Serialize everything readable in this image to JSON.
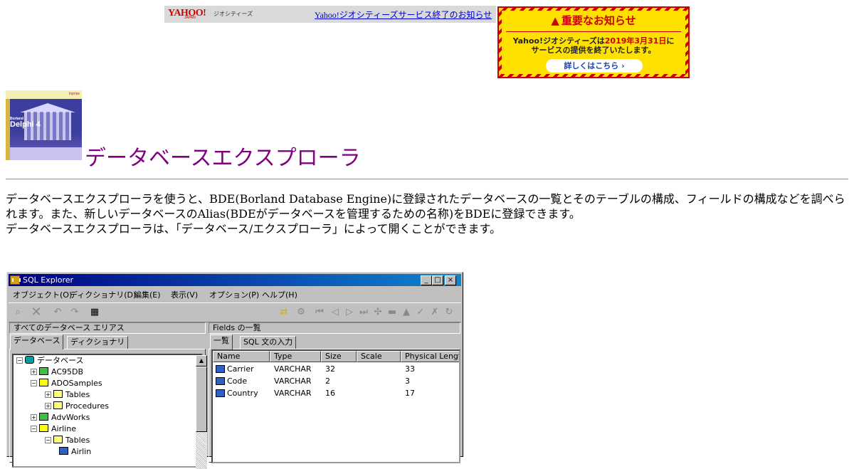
{
  "yahoo_bar": {
    "logo": "YAHOO!",
    "logo_sub": "JAPAN",
    "geocities": "ジオシティーズ",
    "link": "Yahoo!ジオシティーズサービス終了のお知らせ"
  },
  "notice": {
    "title": "重要なお知らせ",
    "line1_a": "Yahoo!ジオシティーズは",
    "line1_date": "2019年3月31日",
    "line1_b": "に",
    "line2": "サービスの提供を終了いたします。",
    "button": "詳しくはこちら ›"
  },
  "box_art": {
    "brand_small": "Borland",
    "product": "Delphi 4",
    "vendor": "Inprise"
  },
  "page": {
    "title": "データベースエクスプローラ",
    "para1": "データベースエクスプローラを使うと、BDE(Borland Database Engine)に登録されたデータベースの一覧とそのテーブルの構成、フィールドの構成などを調べられます。また、新しいデータベースのAlias(BDEがデータベースを管理するための名称)をBDEに登録できます。",
    "para2": "データベースエクスプローラは、「データベース/エクスプローラ」によって開くことができます。"
  },
  "window": {
    "title": "SQL Explorer",
    "controls": {
      "minimize": "_",
      "maximize": "□",
      "close": "×"
    },
    "menu": [
      "オブジェクト(O)",
      "ディクショナリ(D)",
      "編集(E)",
      "表示(V)",
      "オプション(P)",
      "ヘルプ(H)"
    ],
    "left_panel_label": "すべてのデータベース エリアス",
    "right_panel_label": "Fields の一覧",
    "left_tabs": [
      "データベース",
      "ディクショナリ"
    ],
    "right_tabs": [
      "一覧",
      "SQL 文の入力"
    ],
    "tree": [
      {
        "label": "データベース",
        "level": 0,
        "expander": "−",
        "icon": "db"
      },
      {
        "label": "AC95DB",
        "level": 1,
        "expander": "+",
        "icon": "alias"
      },
      {
        "label": "ADOSamples",
        "level": 1,
        "expander": "−",
        "icon": "open"
      },
      {
        "label": "Tables",
        "level": 2,
        "expander": "+",
        "icon": "folder"
      },
      {
        "label": "Procedures",
        "level": 2,
        "expander": "+",
        "icon": "folder"
      },
      {
        "label": "AdvWorks",
        "level": 1,
        "expander": "+",
        "icon": "alias"
      },
      {
        "label": "Airline",
        "level": 1,
        "expander": "−",
        "icon": "open"
      },
      {
        "label": "Tables",
        "level": 2,
        "expander": "−",
        "icon": "folder"
      },
      {
        "label": "Airlin",
        "level": 3,
        "expander": "",
        "icon": "tbl"
      }
    ],
    "grid_columns": [
      "Name",
      "Type",
      "Size",
      "Scale",
      "Physical Length"
    ],
    "grid_rows": [
      [
        "Carrier",
        "VARCHAR",
        "32",
        "",
        "33"
      ],
      [
        "Code",
        "VARCHAR",
        "2",
        "",
        "3"
      ],
      [
        "Country",
        "VARCHAR",
        "16",
        "",
        "17"
      ]
    ]
  }
}
